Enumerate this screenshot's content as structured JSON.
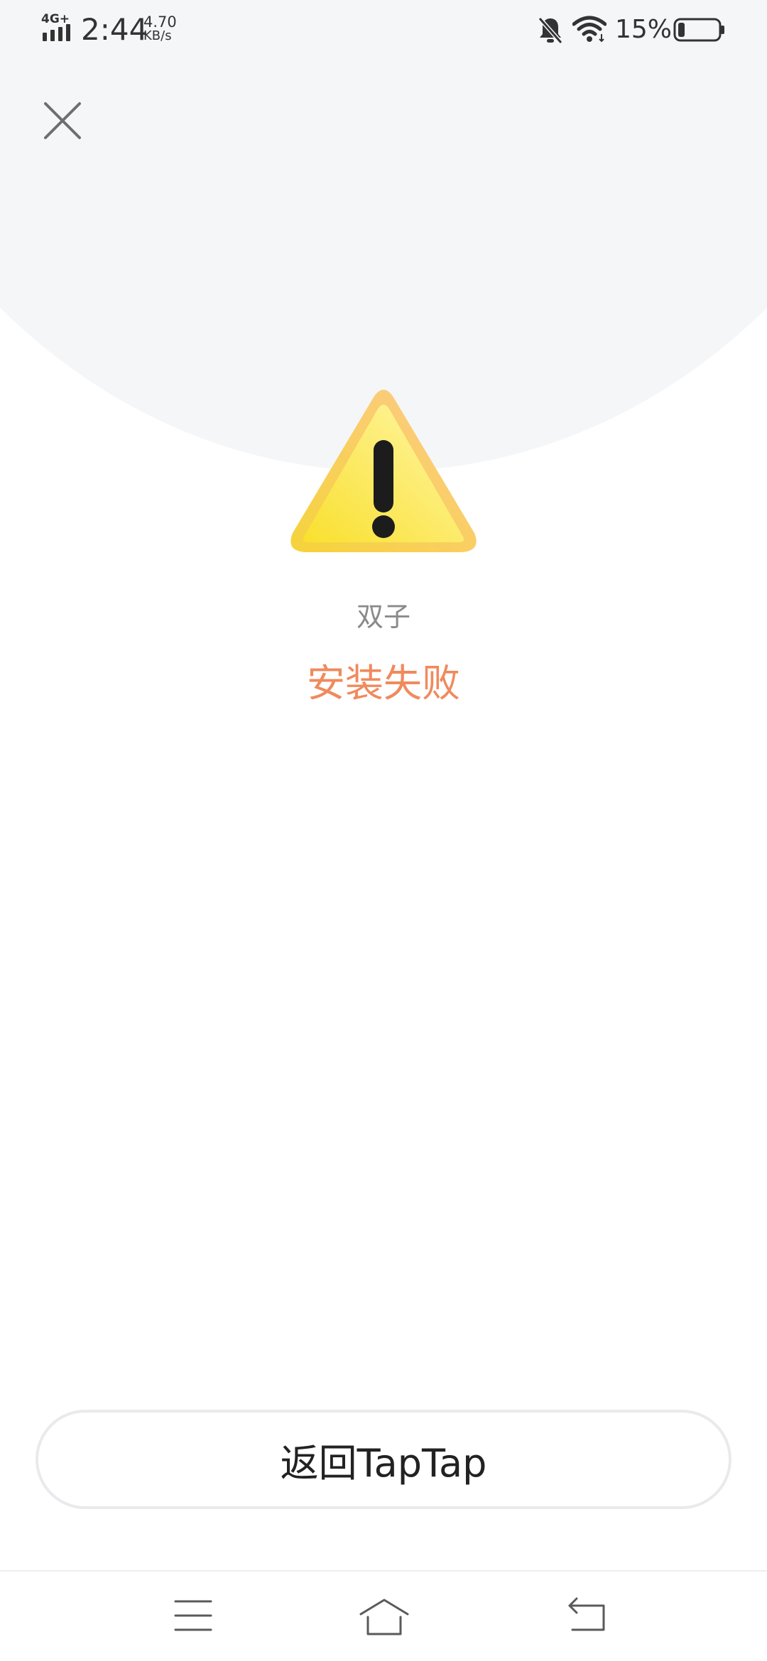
{
  "status_bar": {
    "network_type": "4G+",
    "time": "2:44",
    "speed_value": "4.70",
    "speed_unit": "KB/s",
    "battery_percent": "15%",
    "icons": [
      "signal-icon",
      "bell-off-icon",
      "wifi-icon",
      "battery-icon"
    ]
  },
  "header": {
    "close_icon": "close-icon"
  },
  "main": {
    "warning_icon": "warning-triangle-icon",
    "app_name": "双子",
    "status": "安装失败"
  },
  "footer": {
    "return_button_label": "返回TapTap"
  },
  "nav_bar": {
    "icons": [
      "menu-icon",
      "home-icon",
      "back-icon"
    ]
  },
  "colors": {
    "status_text": "#f08a5d",
    "top_background": "#f5f6f8",
    "warning_yellow": "#fbe64a",
    "warning_orange": "#fdd08a"
  }
}
